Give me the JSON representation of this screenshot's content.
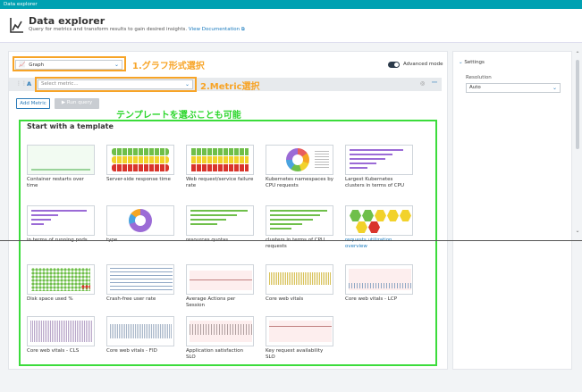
{
  "window": {
    "title": "Data explorer"
  },
  "header": {
    "title": "Data explorer",
    "subtitle": "Query for metrics and transform results to gain desired insights.",
    "doc_link": "View Documentation"
  },
  "toolbar": {
    "chart_type": "Graph",
    "advanced_mode_label": "Advanced mode",
    "query_letter": "A",
    "metric_placeholder": "Select metric...",
    "add_metric_label": "Add Metric",
    "run_query_label": "Run query"
  },
  "annotations": {
    "graph_type": "1.グラフ形式選択",
    "metric": "2.Metric選択",
    "template": "テンプレートを選ぶことも可能"
  },
  "settings": {
    "title": "Settings",
    "resolution_label": "Resolution",
    "resolution_value": "Auto"
  },
  "templates": {
    "title": "Start with a template",
    "items": [
      {
        "label": "Container restarts over time"
      },
      {
        "label": "Server-side response time"
      },
      {
        "label": "Web request/service failure rate"
      },
      {
        "label": "Kubernetes namespaces by CPU requests"
      },
      {
        "label": "Largest Kubernetes clusters in terms of CPU"
      },
      {
        "label": "in terms of running pods"
      },
      {
        "label": "type"
      },
      {
        "label": "resources quotas"
      },
      {
        "label": "clusters in terms of CPU requests"
      },
      {
        "label": "requests utilization overview"
      },
      {
        "label": "Disk space used %"
      },
      {
        "label": "Crash-free user rate"
      },
      {
        "label": "Average Actions per Session"
      },
      {
        "label": "Core web vitals"
      },
      {
        "label": "Core web vitals - LCP"
      },
      {
        "label": "Core web vitals - CLS"
      },
      {
        "label": "Core web vitals - FID"
      },
      {
        "label": "Application satisfaction SLO"
      },
      {
        "label": "Key request availability SLO"
      }
    ]
  },
  "colors": {
    "accent": "#00a1b2",
    "annotation_orange": "#f7a427",
    "annotation_green": "#3cdc3c",
    "link": "#1a7bbf"
  }
}
